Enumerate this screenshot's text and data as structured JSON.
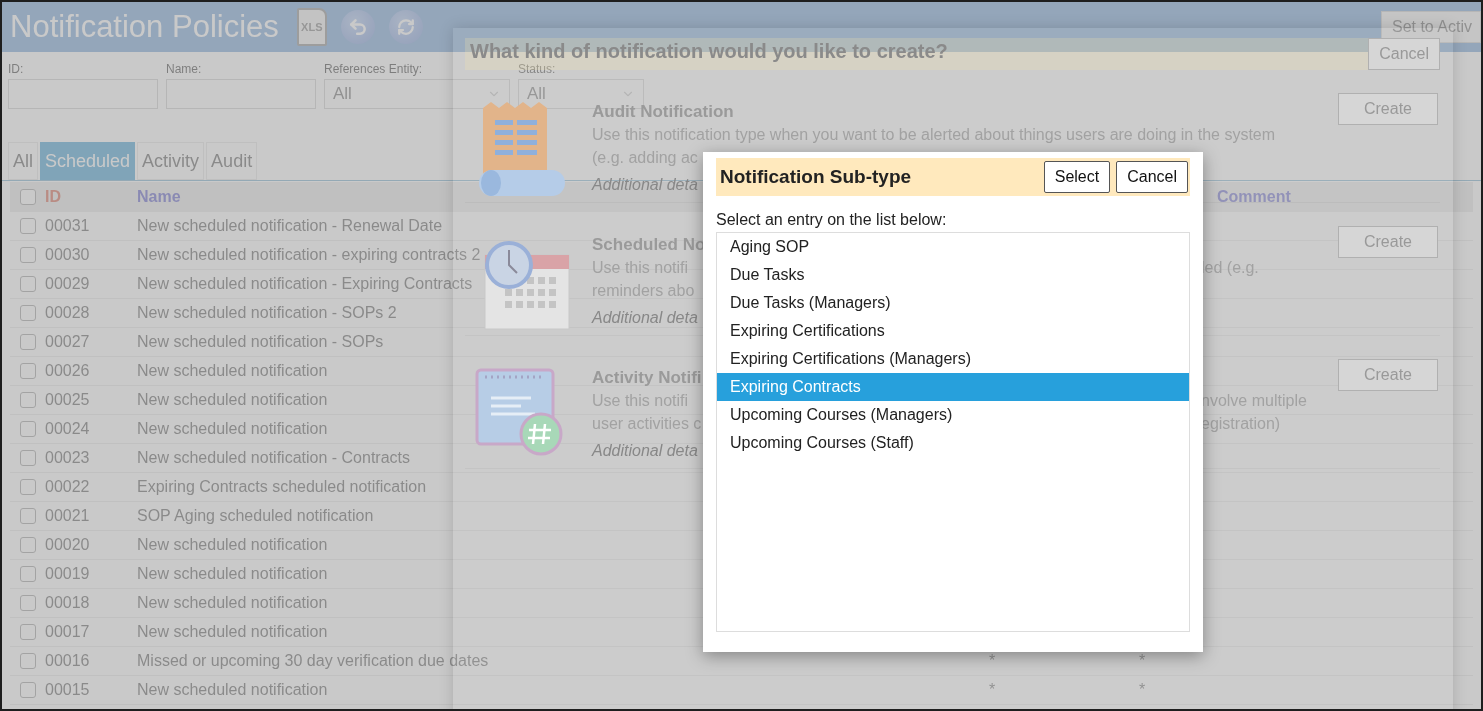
{
  "header": {
    "title": "Notification Policies",
    "export_label": "XLS",
    "set_active": "Set to Activ"
  },
  "filters": [
    {
      "label": "ID:",
      "kind": "text"
    },
    {
      "label": "Name:",
      "kind": "text"
    },
    {
      "label": "References Entity:",
      "kind": "select",
      "value": "All"
    },
    {
      "label": "Status:",
      "kind": "select",
      "value": "All"
    }
  ],
  "tabs": [
    {
      "label": "All",
      "selected": false
    },
    {
      "label": "Scheduled",
      "selected": true
    },
    {
      "label": "Activity",
      "selected": false
    },
    {
      "label": "Audit",
      "selected": false
    }
  ],
  "table": {
    "select_all_checked": false,
    "columns": [
      {
        "label": "ID",
        "kind": "id"
      },
      {
        "label": "Name",
        "kind": "name"
      },
      {
        "kind": "blank"
      },
      {
        "kind": "blank"
      },
      {
        "label": "Comment",
        "kind": "name"
      }
    ],
    "rows": [
      {
        "checked": false,
        "id": "00031",
        "name": "New scheduled notification - Renewal Date"
      },
      {
        "checked": false,
        "id": "00030",
        "name": "New scheduled notification - expiring contracts 2"
      },
      {
        "checked": false,
        "id": "00029",
        "name": "New scheduled notification - Expiring Contracts"
      },
      {
        "checked": false,
        "id": "00028",
        "name": "New scheduled notification - SOPs 2"
      },
      {
        "checked": false,
        "id": "00027",
        "name": "New scheduled notification - SOPs"
      },
      {
        "checked": false,
        "id": "00026",
        "name": "New scheduled notification"
      },
      {
        "checked": false,
        "id": "00025",
        "name": "New scheduled notification"
      },
      {
        "checked": false,
        "id": "00024",
        "name": "New scheduled notification"
      },
      {
        "checked": false,
        "id": "00023",
        "name": "New scheduled notification - Contracts"
      },
      {
        "checked": false,
        "id": "00022",
        "name": "Expiring Contracts scheduled notification"
      },
      {
        "checked": false,
        "id": "00021",
        "name": "SOP Aging scheduled notification"
      },
      {
        "checked": false,
        "id": "00020",
        "name": "New scheduled notification"
      },
      {
        "checked": false,
        "id": "00019",
        "name": "New scheduled notification"
      },
      {
        "checked": false,
        "id": "00018",
        "name": "New scheduled notification"
      },
      {
        "checked": false,
        "id": "00017",
        "name": "New scheduled notification"
      },
      {
        "checked": false,
        "id": "00016",
        "name": "Missed or upcoming 30 day verification due dates",
        "column_3": "*",
        "column_4": "*"
      },
      {
        "checked": false,
        "id": "00015",
        "name": "New scheduled notification",
        "column_3": "*",
        "column_4": "*"
      }
    ]
  },
  "type_dialog": {
    "title": "What kind of notification would you like to create?",
    "cancel": "Cancel",
    "options": [
      {
        "kind": "audit",
        "title": "Audit Notification",
        "lines": [
          {
            "left": "Use this notification type when you want to be alerted about things users are doing in the system"
          },
          {
            "left": "(e.g. adding ac"
          }
        ],
        "details": "Additional deta",
        "create": "Create"
      },
      {
        "kind": "scheduled",
        "title": "Scheduled No",
        "lines": [
          {
            "left": "Use this notifi",
            "right": "led (e.g."
          },
          {
            "left": "reminders abo"
          }
        ],
        "details": "Additional deta",
        "create": "Create"
      },
      {
        "kind": "activity",
        "title": "Activity Notifi",
        "lines": [
          {
            "left": "Use this notifi",
            "right": "nvolve multiple"
          },
          {
            "left": "user activities c",
            "right": "egistration)"
          }
        ],
        "details": "Additional deta",
        "create": "Create"
      }
    ]
  },
  "subtype_dialog": {
    "title": "Notification Sub-type",
    "select": "Select",
    "cancel": "Cancel",
    "prompt": "Select an entry on the list below:",
    "items": [
      {
        "label": "Aging SOP",
        "selected": false
      },
      {
        "label": "Due Tasks",
        "selected": false
      },
      {
        "label": "Due Tasks (Managers)",
        "selected": false
      },
      {
        "label": "Expiring Certifications",
        "selected": false
      },
      {
        "label": "Expiring Certifications (Managers)",
        "selected": false
      },
      {
        "label": "Expiring Contracts",
        "selected": true
      },
      {
        "label": "Upcoming Courses (Managers)",
        "selected": false
      },
      {
        "label": "Upcoming Courses (Staff)",
        "selected": false
      }
    ]
  }
}
